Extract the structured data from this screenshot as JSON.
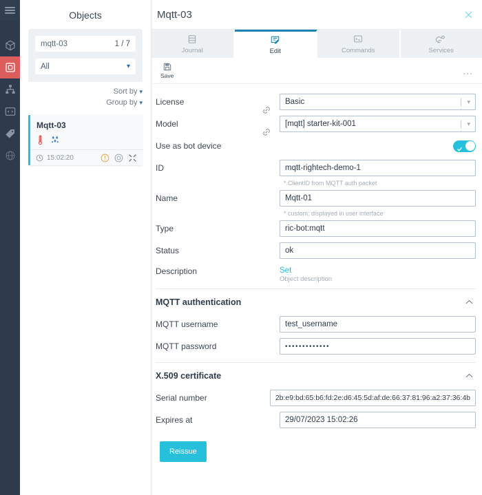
{
  "rail": {
    "menu_icon": "hamburger-menu-icon",
    "items": [
      {
        "icon": "cube-icon",
        "name": "rail-item-models",
        "active": false
      },
      {
        "icon": "object-square-icon",
        "name": "rail-item-objects",
        "active": true
      },
      {
        "icon": "hierarchy-icon",
        "name": "rail-item-hierarchy",
        "active": false
      },
      {
        "icon": "code-window-icon",
        "name": "rail-item-code",
        "active": false
      },
      {
        "icon": "tag-icon",
        "name": "rail-item-tags",
        "active": false
      },
      {
        "icon": "network-globe-icon",
        "name": "rail-item-network",
        "active": false
      }
    ]
  },
  "objects": {
    "title": "Objects",
    "search": {
      "value": "mqtt-03",
      "count": "1 / 7"
    },
    "filter": {
      "value": "All"
    },
    "sort_by": "Sort by",
    "group_by": "Group by",
    "card": {
      "title": "Mqtt-03",
      "time": "15:02:20",
      "sensor_icons": [
        "thermometer-icon",
        "humidity-icon"
      ],
      "status_icons": [
        "alert-circle-icon",
        "target-circle-icon",
        "collapse-arrows-icon"
      ]
    }
  },
  "detail": {
    "title": "Mqtt-03",
    "close_label": "close-icon",
    "tabs": [
      {
        "label": "Journal",
        "icon": "journal-icon",
        "active": false
      },
      {
        "label": "Edit",
        "icon": "edit-icon",
        "active": true
      },
      {
        "label": "Commands",
        "icon": "terminal-icon",
        "active": false
      },
      {
        "label": "Services",
        "icon": "services-gear-icon",
        "active": false
      }
    ],
    "toolbar": {
      "save_label": "Save",
      "more_label": "..."
    },
    "fields": {
      "license": {
        "label": "License",
        "value": "Basic"
      },
      "model": {
        "label": "Model",
        "value": "[mqtt] starter-kit-001"
      },
      "bot_device": {
        "label": "Use as bot device",
        "on": true
      },
      "id": {
        "label": "ID",
        "value": "mqtt-rightech-demo-1",
        "hint": "* ClientID from MQTT auth packet"
      },
      "name": {
        "label": "Name",
        "value": "Mqtt-01",
        "hint": "* custom; displayed in user interface"
      },
      "type": {
        "label": "Type",
        "value": "ric-bot:mqtt"
      },
      "status": {
        "label": "Status",
        "value": "ok"
      },
      "description": {
        "label": "Description",
        "action": "Set",
        "hint": "Object description"
      }
    },
    "mqtt_auth": {
      "title": "MQTT authentication",
      "username": {
        "label": "MQTT username",
        "value": "test_username"
      },
      "password": {
        "label": "MQTT password",
        "value": "•••••••••••••"
      }
    },
    "x509": {
      "title": "X.509 certificate",
      "serial": {
        "label": "Serial number",
        "value": "2b:e9:bd:65:b6:fd:2e:d6:45:5d:af:de:66:37:81:96:a2:37:36:4b"
      },
      "expires": {
        "label": "Expires at",
        "value": "29/07/2023 15:02:26"
      },
      "reissue_label": "Reissue"
    }
  },
  "colors": {
    "accent": "#27c0dc",
    "tab_active": "#1d84b5",
    "rail_bg": "#2f3b4c",
    "rail_active": "#dd5c5c"
  }
}
